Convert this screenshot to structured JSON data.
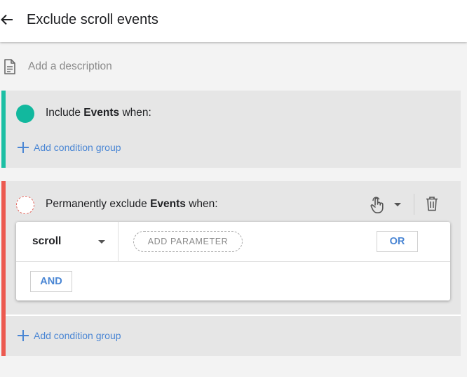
{
  "header": {
    "title": "Exclude scroll events"
  },
  "description": {
    "placeholder": "Add a description",
    "value": ""
  },
  "include_card": {
    "prefix": "Include",
    "subject": "Events",
    "suffix": "when:",
    "add_group_label": "Add condition group",
    "accent_color": "#1cbfa4"
  },
  "exclude_card": {
    "prefix": "Permanently exclude",
    "subject": "Events",
    "suffix": "when:",
    "add_group_label": "Add condition group",
    "accent_color": "#ec5a50",
    "condition": {
      "event_name": "scroll",
      "add_parameter_label": "ADD PARAMETER",
      "or_label": "OR",
      "and_label": "AND"
    }
  },
  "icons": {
    "back": "arrow-back-icon",
    "description": "document-icon",
    "add": "plus-icon",
    "gesture": "touch-hand-icon",
    "dropdown": "caret-down-icon",
    "delete": "trash-icon"
  },
  "colors": {
    "link_blue": "#4a86d4",
    "card_background": "#e6e6e6",
    "page_background": "#f3f3f3"
  }
}
